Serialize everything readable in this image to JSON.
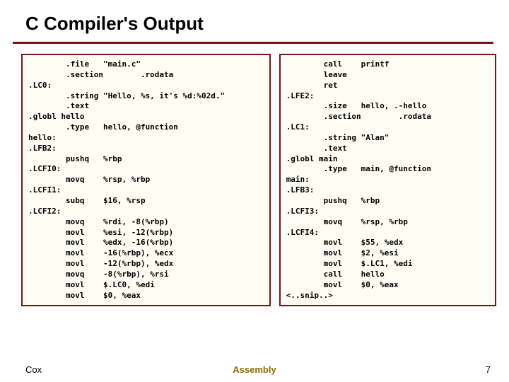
{
  "title": "C Compiler's Output",
  "code_left": "        .file   \"main.c\"\n        .section        .rodata\n.LC0:\n        .string \"Hello, %s, it's %d:%02d.\"\n        .text\n.globl hello\n        .type   hello, @function\nhello:\n.LFB2:\n        pushq   %rbp\n.LCFI0:\n        movq    %rsp, %rbp\n.LCFI1:\n        subq    $16, %rsp\n.LCFI2:\n        movq    %rdi, -8(%rbp)\n        movl    %esi, -12(%rbp)\n        movl    %edx, -16(%rbp)\n        movl    -16(%rbp), %ecx\n        movl    -12(%rbp), %edx\n        movq    -8(%rbp), %rsi\n        movl    $.LC0, %edi\n        movl    $0, %eax",
  "code_right": "        call    printf\n        leave\n        ret\n.LFE2:\n        .size   hello, .-hello\n        .section        .rodata\n.LC1:\n        .string \"Alan\"\n        .text\n.globl main\n        .type   main, @function\nmain:\n.LFB3:\n        pushq   %rbp\n.LCFI3:\n        movq    %rsp, %rbp\n.LCFI4:\n        movl    $55, %edx\n        movl    $2, %esi\n        movl    $.LC1, %edi\n        call    hello\n        movl    $0, %eax\n<..snip..>",
  "footer": {
    "left": "Cox",
    "center": "Assembly",
    "right": "7"
  }
}
